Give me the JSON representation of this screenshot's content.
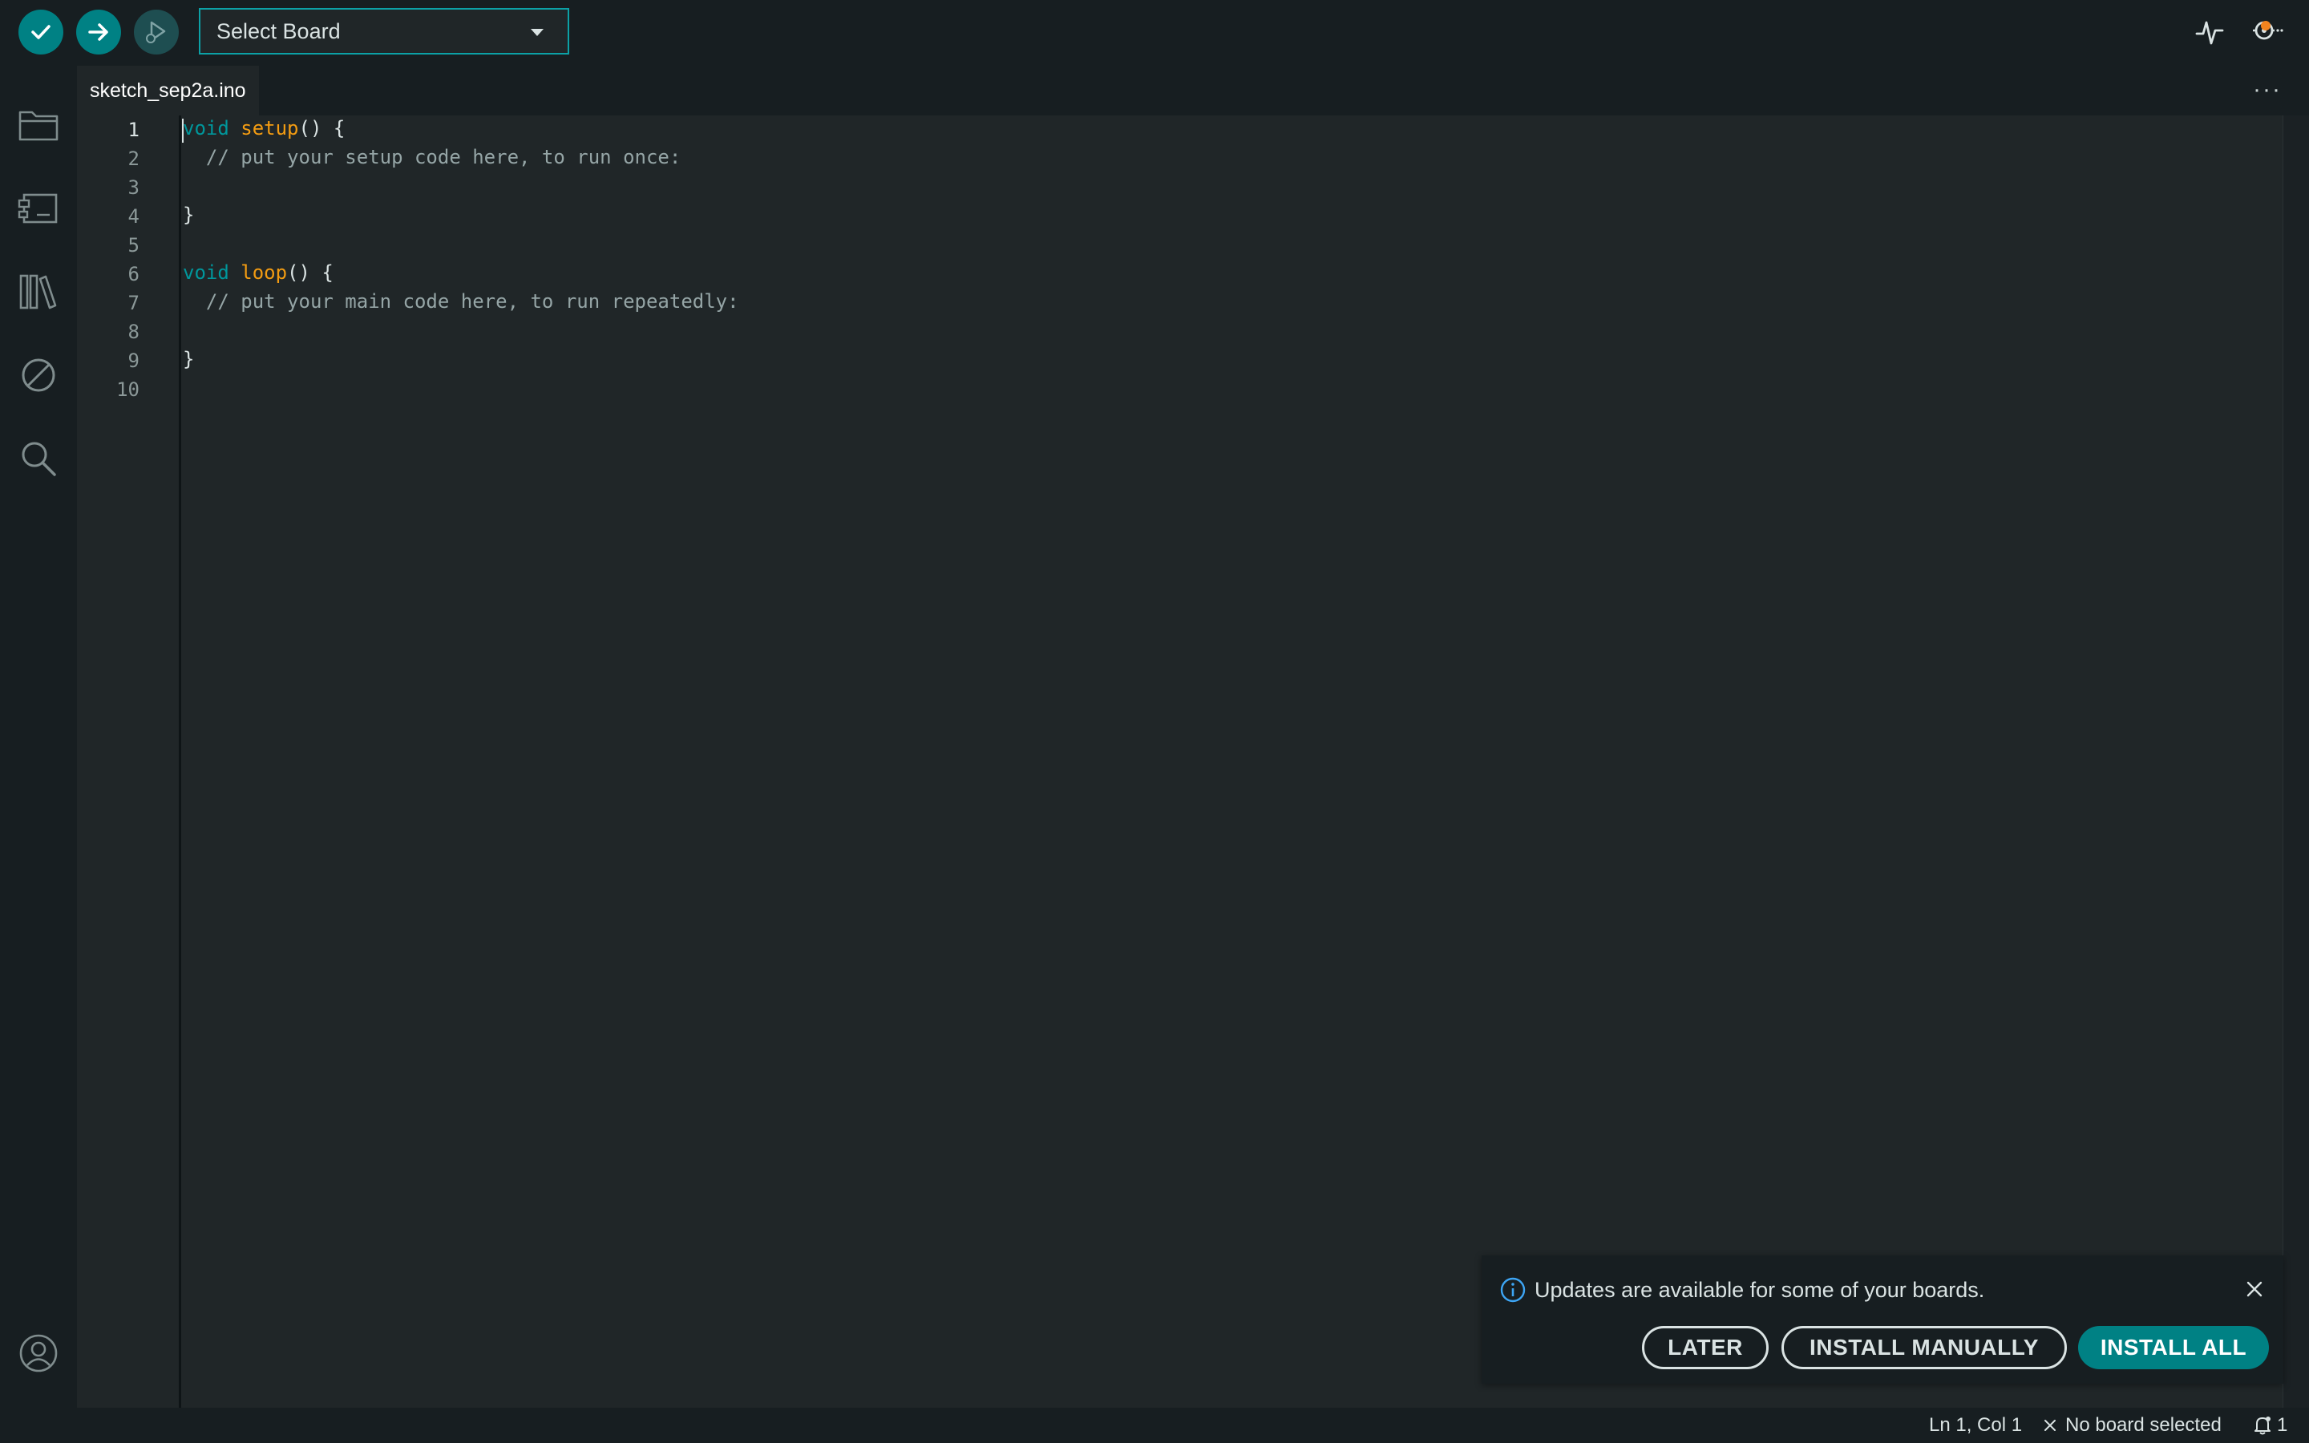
{
  "toolbar": {
    "verify_icon": "checkmark-icon",
    "upload_icon": "arrow-right-icon",
    "debug_icon": "debug-icon",
    "board_select": {
      "label": "Select Board"
    },
    "serial_plotter_icon": "serial-plotter-icon",
    "serial_monitor_icon": "serial-monitor-icon",
    "accent_color": "#008184"
  },
  "activity_bar": {
    "items": [
      {
        "name": "sketchbook",
        "icon": "folder-icon"
      },
      {
        "name": "boards-manager",
        "icon": "board-icon"
      },
      {
        "name": "library-manager",
        "icon": "library-icon"
      },
      {
        "name": "debug",
        "icon": "no-debug-icon"
      },
      {
        "name": "search",
        "icon": "search-icon"
      }
    ],
    "account_icon": "account-icon"
  },
  "tabs": [
    {
      "label": "sketch_sep2a.ino",
      "active": true
    }
  ],
  "editor": {
    "line_numbers": [
      "1",
      "2",
      "3",
      "4",
      "5",
      "6",
      "7",
      "8",
      "9",
      "10"
    ],
    "lines": {
      "l1_kw": "void",
      "l1_fn": "setup",
      "l1_rest": "() {",
      "l2": "  // put your setup code here, to run once:",
      "l4": "}",
      "l6_kw": "void",
      "l6_fn": "loop",
      "l6_rest": "() {",
      "l7": "  // put your main code here, to run repeatedly:",
      "l9": "}"
    }
  },
  "notification": {
    "message": "Updates are available for some of your boards.",
    "buttons": {
      "later": "LATER",
      "install_manually": "INSTALL MANUALLY",
      "install_all": "INSTALL ALL"
    }
  },
  "status_bar": {
    "cursor_position": "Ln 1, Col 1",
    "board_status": "No board selected",
    "notification_count": "1"
  }
}
